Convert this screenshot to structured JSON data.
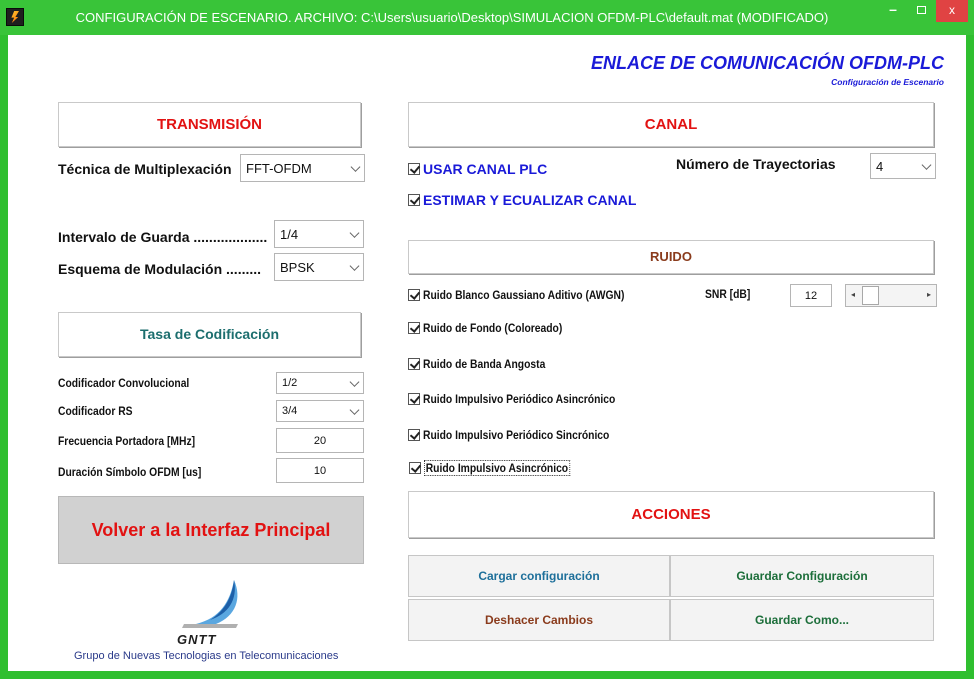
{
  "window": {
    "title": "CONFIGURACIÓN DE ESCENARIO. ARCHIVO:  C:\\Users\\usuario\\Desktop\\SIMULACION OFDM-PLC\\default.mat (MODIFICADO)",
    "close_glyph": "x",
    "min_glyph": "–"
  },
  "header": {
    "title": "ENLACE DE COMUNICACIÓN OFDM-PLC",
    "subtitle": "Configuración de Escenario"
  },
  "colors": {
    "titlebar": "#39c439",
    "accent_red": "#e21212",
    "accent_blue": "#1a1ad8",
    "teal": "#1c6e6e",
    "brown": "#8a3b1c"
  },
  "transmision": {
    "heading": "TRANSMISIÓN",
    "multiplex_label": "Técnica de Multiplexación",
    "multiplex_value": "FFT-OFDM",
    "guard_label": "Intervalo de Guarda ...................",
    "guard_value": "1/4",
    "modulation_label": "Esquema de Modulación .........",
    "modulation_value": "BPSK"
  },
  "codificacion": {
    "heading": "Tasa de Codificación",
    "conv_label": "Codificador Convolucional",
    "conv_value": "1/2",
    "rs_label": "Codificador RS",
    "rs_value": "3/4",
    "freq_label": "Frecuencia Portadora [MHz]",
    "freq_value": "20",
    "duration_label": "Duración Símbolo OFDM [us]",
    "duration_value": "10"
  },
  "back_button": "Volver a la Interfaz Principal",
  "logo": {
    "text": "GNTT",
    "caption": "Grupo de Nuevas Tecnologias en Telecomunicaciones"
  },
  "canal": {
    "heading": "CANAL",
    "use_plc": "USAR CANAL PLC",
    "estimate": "ESTIMAR Y ECUALIZAR CANAL",
    "paths_label": "Número de Trayectorias",
    "paths_value": "4"
  },
  "ruido": {
    "heading": "RUIDO",
    "awgn": "Ruido Blanco Gaussiano Aditivo (AWGN)",
    "snr_label": "SNR  [dB]",
    "snr_value": "12",
    "fondo": "Ruido de Fondo (Coloreado)",
    "banda": "Ruido de Banda Angosta",
    "imp_per_asinc": "Ruido Impulsivo Periódico Asincrónico",
    "imp_per_sinc": "Ruido Impulsivo Periódico Sincrónico",
    "imp_asinc": "Ruido Impulsivo Asincrónico"
  },
  "acciones": {
    "heading": "ACCIONES",
    "load": "Cargar configuración",
    "save": "Guardar Configuración",
    "undo": "Deshacer Cambios",
    "save_as": "Guardar Como..."
  }
}
